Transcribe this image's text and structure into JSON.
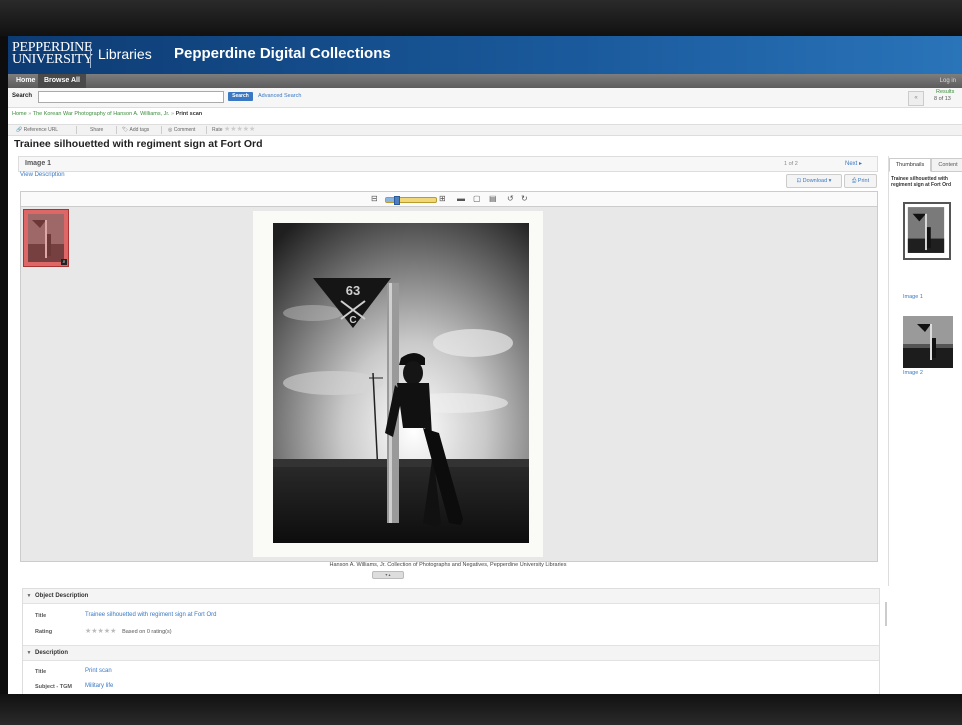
{
  "header": {
    "logo_line1": "PEPPERDINE",
    "logo_line2": "UNIVERSITY",
    "libraries": "Libraries",
    "site_title": "Pepperdine Digital Collections"
  },
  "nav": {
    "home": "Home",
    "browse_all": "Browse All",
    "login": "Log in"
  },
  "search": {
    "label": "Search",
    "input_value": "",
    "button": "Search",
    "advanced": "Advanced Search"
  },
  "results": {
    "label": "Results",
    "count": "8 of 13"
  },
  "breadcrumb": {
    "home": "Home",
    "collection": "The Korean War Photography of Hanson A. Williams, Jr.",
    "current": "Print scan"
  },
  "toolbar": {
    "reference_url": "Reference URL",
    "share": "Share",
    "add_tags": "Add tags",
    "comment": "Comment",
    "rate": "Rate",
    "stars": "★★★★★"
  },
  "item": {
    "title": "Trainee silhouetted with regiment sign at Fort Ord"
  },
  "viewer": {
    "image_label": "Image 1",
    "page_count": "1 of 2",
    "next": "Next ▸",
    "view_description": "View Description",
    "download": "⊡ Download  ▾",
    "print": "⎙ Print",
    "zoom_level": 0.2,
    "caption": "Hanson A. Williams, Jr. Collection of Photographs and Negatives, Pepperdine University Libraries",
    "sign_number": "63",
    "sign_letter": "C"
  },
  "description": {
    "object_description": "Object Description",
    "title_label": "Title",
    "title_value": "Trainee silhouetted with regiment sign at Fort Ord",
    "rating_label": "Rating",
    "rating_stars": "★★★★★",
    "rating_text": "Based on 0 rating(s)",
    "description_header": "Description",
    "desc_title_label": "Title",
    "desc_title_value": "Print scan",
    "subject_label": "Subject - TGM",
    "subject_value": "Military life"
  },
  "sidebar": {
    "tab_thumbnails": "Thumbnails",
    "tab_content": "Content",
    "title": "Trainee silhouetted with regiment sign at Fort Ord",
    "thumb1_label": "Image 1",
    "thumb2_label": "Image 2"
  },
  "colors": {
    "banner": "#1a5a9c",
    "link": "#3a78c3",
    "breadcrumb": "#3a8e3a"
  }
}
